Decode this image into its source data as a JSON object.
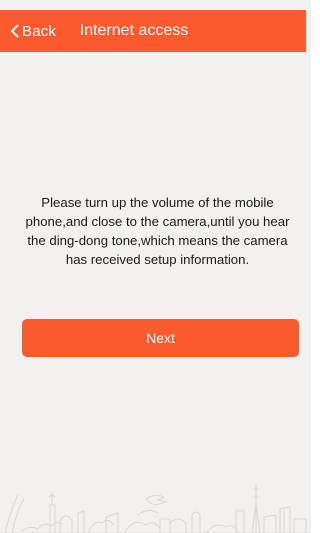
{
  "header": {
    "back_label": "Back",
    "back_icon": "chevron-left-icon",
    "title": "Internet access"
  },
  "main": {
    "instruction": "Please turn up the volume of the mobile phone,and close to the camera,until you hear the ding-dong tone,which means the camera has received setup information.",
    "next_label": "Next"
  },
  "colors": {
    "accent": "#fb5a2f",
    "background": "#f3f1f0",
    "text": "#1a1a1a"
  }
}
